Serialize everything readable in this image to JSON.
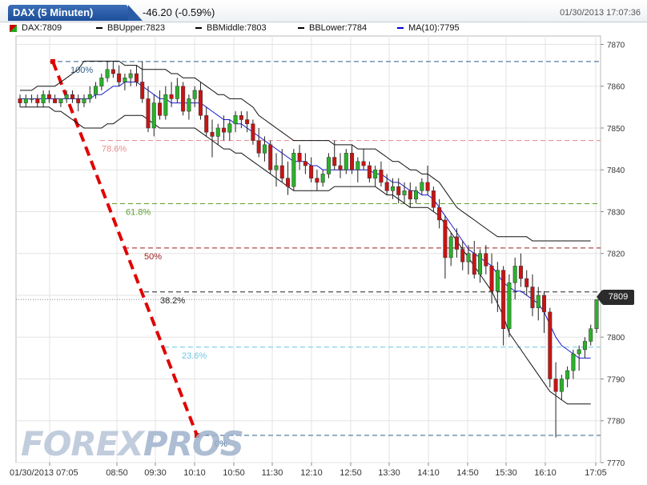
{
  "header": {
    "title": "DAX (5 Minuten)",
    "change": "-46.20 (-0.59%)",
    "datetime": "01/30/2013 17:07:36"
  },
  "legend": {
    "items": [
      {
        "label": "DAX:7809",
        "color": "#cc0000"
      },
      {
        "label": "BBUpper:7823",
        "color": "#000000"
      },
      {
        "label": "BBMiddle:7803",
        "color": "#000000"
      },
      {
        "label": "BBLower:7784",
        "color": "#000000"
      },
      {
        "label": "MA(10):7795",
        "color": "#0000cc"
      }
    ]
  },
  "watermark": {
    "part1": "FOREX",
    "part2": "PROS"
  },
  "last_price_label": "7809",
  "chart_data": {
    "type": "candlestick",
    "x_axis": {
      "tick_labels": [
        "01/30/2013 07:05",
        "08:50",
        "09:30",
        "10:10",
        "10:50",
        "11:30",
        "12:10",
        "12:50",
        "13:30",
        "14:10",
        "14:50",
        "15:30",
        "16:10",
        "17:05"
      ]
    },
    "y_axis": {
      "range": [
        7770,
        7872
      ],
      "tick_labels": [
        "7870",
        "7860",
        "7850",
        "7840",
        "7830",
        "7820",
        "7810",
        "7800",
        "7790",
        "7780",
        "7770"
      ],
      "ticks": [
        7870,
        7860,
        7850,
        7840,
        7830,
        7820,
        7810,
        7800,
        7790,
        7780,
        7770
      ]
    },
    "grid": true,
    "fibonacci": {
      "levels": [
        {
          "label": "100%",
          "value": 7865.9,
          "color": "#2f5f8a"
        },
        {
          "label": "78.6%",
          "value": 7847.0,
          "color": "#e98b8b"
        },
        {
          "label": "61.8%",
          "value": 7831.9,
          "color": "#5aa02c"
        },
        {
          "label": "50%",
          "value": 7821.3,
          "color": "#9b1b1b"
        },
        {
          "label": "38.2%",
          "value": 7810.8,
          "color": "#222222"
        },
        {
          "label": "23.6%",
          "value": 7797.6,
          "color": "#6cc7e3"
        },
        {
          "label": "0%",
          "value": 7776.5,
          "color": "#2f5f8a"
        }
      ],
      "trend_line": {
        "from": {
          "bar": 12,
          "value": 7865.9
        },
        "to": {
          "bar": 60,
          "value": 7776.5
        },
        "color": "#e00000"
      }
    },
    "last_price": 7809,
    "series": {
      "ohlc": [
        [
          7857,
          7858,
          7855,
          7856
        ],
        [
          7856,
          7858,
          7855,
          7857
        ],
        [
          7857,
          7858,
          7856,
          7857
        ],
        [
          7857,
          7858,
          7855,
          7856
        ],
        [
          7856,
          7859,
          7855,
          7858
        ],
        [
          7858,
          7859,
          7856,
          7857
        ],
        [
          7857,
          7858,
          7856,
          7856
        ],
        [
          7856,
          7857,
          7855,
          7857
        ],
        [
          7857,
          7859,
          7856,
          7858
        ],
        [
          7858,
          7859,
          7856,
          7857
        ],
        [
          7857,
          7858,
          7854,
          7856
        ],
        [
          7856,
          7858,
          7855,
          7857
        ],
        [
          7857,
          7860,
          7856,
          7858
        ],
        [
          7858,
          7861,
          7857,
          7860
        ],
        [
          7860,
          7863,
          7859,
          7862
        ],
        [
          7862,
          7866,
          7861,
          7864
        ],
        [
          7864,
          7866,
          7862,
          7863
        ],
        [
          7863,
          7865,
          7860,
          7861
        ],
        [
          7861,
          7863,
          7859,
          7862
        ],
        [
          7862,
          7864,
          7860,
          7863
        ],
        [
          7863,
          7865,
          7860,
          7861
        ],
        [
          7861,
          7866,
          7856,
          7857
        ],
        [
          7857,
          7860,
          7849,
          7850
        ],
        [
          7850,
          7858,
          7848,
          7856
        ],
        [
          7856,
          7859,
          7852,
          7853
        ],
        [
          7853,
          7860,
          7852,
          7858
        ],
        [
          7858,
          7861,
          7855,
          7857
        ],
        [
          7857,
          7862,
          7856,
          7860
        ],
        [
          7860,
          7861,
          7853,
          7854
        ],
        [
          7854,
          7858,
          7852,
          7857
        ],
        [
          7857,
          7860,
          7855,
          7859
        ],
        [
          7859,
          7861,
          7852,
          7853
        ],
        [
          7853,
          7855,
          7848,
          7849
        ],
        [
          7849,
          7852,
          7843,
          7848
        ],
        [
          7848,
          7851,
          7846,
          7850
        ],
        [
          7850,
          7853,
          7847,
          7849
        ],
        [
          7849,
          7852,
          7847,
          7851
        ],
        [
          7851,
          7854,
          7849,
          7853
        ],
        [
          7853,
          7854,
          7850,
          7852
        ],
        [
          7852,
          7854,
          7849,
          7851
        ],
        [
          7851,
          7852,
          7846,
          7847
        ],
        [
          7847,
          7850,
          7843,
          7844
        ],
        [
          7844,
          7848,
          7842,
          7846
        ],
        [
          7846,
          7847,
          7839,
          7840
        ],
        [
          7840,
          7844,
          7836,
          7841
        ],
        [
          7841,
          7845,
          7837,
          7838
        ],
        [
          7838,
          7842,
          7834,
          7836
        ],
        [
          7836,
          7845,
          7835,
          7844
        ],
        [
          7844,
          7846,
          7840,
          7842
        ],
        [
          7842,
          7844,
          7839,
          7841
        ],
        [
          7841,
          7843,
          7837,
          7838
        ],
        [
          7838,
          7840,
          7835,
          7837
        ],
        [
          7837,
          7840,
          7836,
          7839
        ],
        [
          7839,
          7844,
          7838,
          7843
        ],
        [
          7843,
          7847,
          7840,
          7841
        ],
        [
          7841,
          7844,
          7838,
          7840
        ],
        [
          7840,
          7845,
          7839,
          7844
        ],
        [
          7844,
          7846,
          7839,
          7840
        ],
        [
          7840,
          7843,
          7837,
          7842
        ],
        [
          7842,
          7845,
          7840,
          7841
        ],
        [
          7841,
          7842,
          7837,
          7838
        ],
        [
          7838,
          7841,
          7836,
          7840
        ],
        [
          7840,
          7842,
          7836,
          7837
        ],
        [
          7837,
          7839,
          7834,
          7835
        ],
        [
          7835,
          7838,
          7833,
          7836
        ],
        [
          7836,
          7838,
          7832,
          7834
        ],
        [
          7834,
          7837,
          7832,
          7835
        ],
        [
          7835,
          7837,
          7831,
          7833
        ],
        [
          7833,
          7836,
          7832,
          7835
        ],
        [
          7835,
          7838,
          7834,
          7837
        ],
        [
          7837,
          7841,
          7834,
          7835
        ],
        [
          7835,
          7836,
          7830,
          7831
        ],
        [
          7831,
          7833,
          7826,
          7828
        ],
        [
          7828,
          7829,
          7814,
          7819
        ],
        [
          7819,
          7825,
          7817,
          7824
        ],
        [
          7824,
          7826,
          7819,
          7821
        ],
        [
          7821,
          7823,
          7816,
          7818
        ],
        [
          7818,
          7822,
          7815,
          7820
        ],
        [
          7820,
          7823,
          7814,
          7815
        ],
        [
          7815,
          7821,
          7813,
          7820
        ],
        [
          7820,
          7822,
          7815,
          7817
        ],
        [
          7817,
          7820,
          7808,
          7811
        ],
        [
          7811,
          7818,
          7806,
          7816
        ],
        [
          7816,
          7817,
          7798,
          7802
        ],
        [
          7802,
          7815,
          7800,
          7813
        ],
        [
          7813,
          7819,
          7809,
          7817
        ],
        [
          7817,
          7820,
          7812,
          7814
        ],
        [
          7814,
          7816,
          7810,
          7812
        ],
        [
          7812,
          7815,
          7805,
          7807
        ],
        [
          7807,
          7812,
          7804,
          7810
        ],
        [
          7810,
          7811,
          7801,
          7806
        ],
        [
          7806,
          7807,
          7788,
          7790
        ],
        [
          7790,
          7794,
          7776,
          7787
        ],
        [
          7787,
          7791,
          7785,
          7790
        ],
        [
          7790,
          7793,
          7788,
          7792
        ],
        [
          7792,
          7797,
          7790,
          7796
        ],
        [
          7796,
          7798,
          7792,
          7797
        ],
        [
          7797,
          7800,
          7795,
          7799
        ],
        [
          7799,
          7803,
          7798,
          7802
        ],
        [
          7802,
          7809,
          7801,
          7809
        ]
      ],
      "bb_upper": [
        7859,
        7859,
        7859,
        7860,
        7860,
        7860,
        7860,
        7861,
        7862,
        7863,
        7864,
        7866,
        7866,
        7866,
        7866,
        7866,
        7866,
        7866,
        7865,
        7865,
        7865,
        7864,
        7864,
        7864,
        7864,
        7864,
        7863,
        7863,
        7862,
        7862,
        7862,
        7861,
        7860,
        7859,
        7858,
        7858,
        7857,
        7857,
        7857,
        7856,
        7855,
        7853,
        7852,
        7851,
        7850,
        7849,
        7848,
        7847,
        7847,
        7847,
        7847,
        7847,
        7847,
        7847,
        7846,
        7846,
        7846,
        7846,
        7845,
        7845,
        7845,
        7845,
        7844,
        7843,
        7842,
        7842,
        7841,
        7840,
        7840,
        7839,
        7839,
        7838,
        7837,
        7835,
        7833,
        7831,
        7830,
        7829,
        7828,
        7827,
        7826,
        7825,
        7824,
        7824,
        7824,
        7824,
        7824,
        7824,
        7823,
        7823,
        7823,
        7823,
        7823,
        7823,
        7823,
        7823,
        7823,
        7823,
        7823
      ],
      "bb_middle": [
        7857,
        7857,
        7857,
        7857,
        7857,
        7857,
        7857,
        7857,
        7857,
        7857,
        7857,
        7857,
        7858,
        7858,
        7858,
        7859,
        7859,
        7859,
        7860,
        7860,
        7860,
        7860,
        7859,
        7859,
        7858,
        7858,
        7858,
        7858,
        7857,
        7857,
        7857,
        7856,
        7855,
        7854,
        7854,
        7853,
        7853,
        7852,
        7852,
        7851,
        7850,
        7849,
        7848,
        7847,
        7846,
        7845,
        7844,
        7843,
        7843,
        7842,
        7842,
        7841,
        7841,
        7841,
        7840,
        7840,
        7840,
        7840,
        7840,
        7840,
        7840,
        7839,
        7839,
        7838,
        7838,
        7837,
        7836,
        7836,
        7835,
        7835,
        7835,
        7834,
        7833,
        7831,
        7829,
        7828,
        7826,
        7825,
        7824,
        7823,
        7822,
        7820,
        7818,
        7816,
        7815,
        7814,
        7813,
        7812,
        7811,
        7810,
        7809,
        7807,
        7805,
        7804,
        7803,
        7803,
        7803,
        7803,
        7803
      ],
      "bb_lower": [
        7855,
        7855,
        7855,
        7855,
        7855,
        7855,
        7854,
        7854,
        7853,
        7852,
        7851,
        7850,
        7850,
        7850,
        7850,
        7851,
        7851,
        7852,
        7853,
        7853,
        7853,
        7853,
        7852,
        7851,
        7850,
        7850,
        7850,
        7850,
        7850,
        7850,
        7850,
        7849,
        7848,
        7847,
        7846,
        7845,
        7845,
        7844,
        7844,
        7843,
        7842,
        7841,
        7840,
        7839,
        7838,
        7837,
        7836,
        7835,
        7835,
        7835,
        7835,
        7835,
        7835,
        7835,
        7836,
        7836,
        7836,
        7836,
        7836,
        7836,
        7836,
        7836,
        7835,
        7834,
        7834,
        7833,
        7832,
        7831,
        7831,
        7831,
        7831,
        7830,
        7829,
        7827,
        7825,
        7823,
        7821,
        7819,
        7817,
        7815,
        7813,
        7811,
        7808,
        7805,
        7801,
        7799,
        7797,
        7795,
        7793,
        7791,
        7789,
        7787,
        7786,
        7785,
        7784,
        7784,
        7784,
        7784,
        7784
      ],
      "ma10": [
        7857,
        7857,
        7857,
        7857,
        7857,
        7857,
        7857,
        7857,
        7857,
        7857,
        7857,
        7857,
        7857,
        7858,
        7858,
        7859,
        7860,
        7860,
        7861,
        7861,
        7861,
        7860,
        7859,
        7858,
        7857,
        7857,
        7856,
        7856,
        7856,
        7856,
        7856,
        7856,
        7855,
        7854,
        7853,
        7852,
        7852,
        7851,
        7851,
        7850,
        7849,
        7848,
        7847,
        7846,
        7845,
        7844,
        7843,
        7842,
        7842,
        7842,
        7841,
        7841,
        7840,
        7840,
        7840,
        7840,
        7840,
        7840,
        7840,
        7840,
        7840,
        7839,
        7839,
        7838,
        7837,
        7837,
        7836,
        7835,
        7835,
        7834,
        7834,
        7833,
        7831,
        7829,
        7827,
        7825,
        7823,
        7821,
        7820,
        7819,
        7818,
        7817,
        7815,
        7813,
        7812,
        7811,
        7811,
        7810,
        7809,
        7808,
        7806,
        7803,
        7800,
        7798,
        7797,
        7796,
        7795,
        7795,
        7795
      ]
    }
  }
}
